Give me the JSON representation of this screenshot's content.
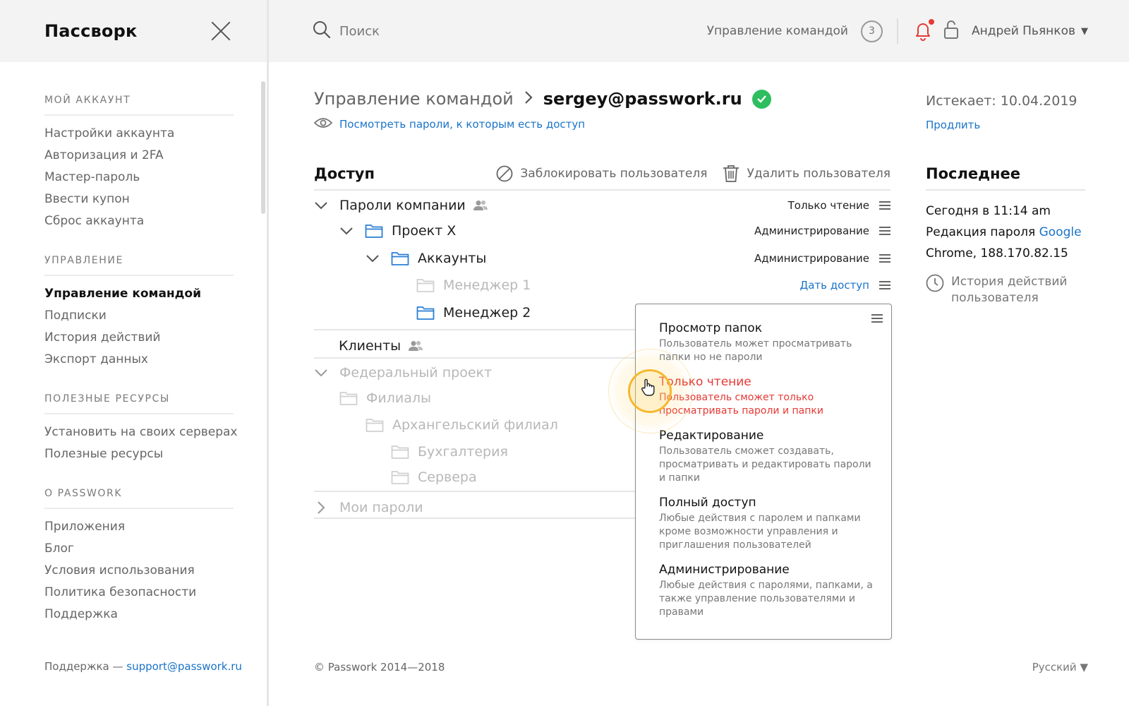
{
  "sidebar": {
    "brand": "Пассворк",
    "sections": [
      {
        "title": "МОЙ АККАУНТ",
        "items": [
          "Настройки аккаунта",
          "Авторизация и 2FA",
          "Мастер-пароль",
          "Ввести купон",
          "Сброс аккаунта"
        ]
      },
      {
        "title": "УПРАВЛЕНИЕ",
        "items": [
          "Управление командой",
          "Подписки",
          "История действий",
          "Экспорт данных"
        ],
        "active": "Управление командой"
      },
      {
        "title": "ПОЛЕЗНЫЕ РЕСУРСЫ",
        "items": [
          "Установить на своих серверах",
          "Полезные ресурсы"
        ]
      },
      {
        "title": "О PASSWORK",
        "items": [
          "Приложения",
          "Блог",
          "Условия использования",
          "Политика безопасности",
          "Поддержка"
        ]
      }
    ],
    "footer_label": "Поддержка —",
    "footer_email": "support@passwork.ru"
  },
  "topbar": {
    "search_placeholder": "Поиск",
    "team_link": "Управление командой",
    "team_count": "3",
    "user_name": "Андрей Пьянков"
  },
  "main": {
    "breadcrumb_parent": "Управление командой",
    "breadcrumb_current": "sergey@passwork.ru",
    "view_link": "Посмотреть пароли, к которым есть доступ",
    "access_title": "Доступ",
    "block_user": "Заблокировать пользователя",
    "delete_user": "Удалить пользователя",
    "tree": [
      {
        "label": "Пароли компании",
        "perm": "Только чтение"
      },
      {
        "label": "Проект X",
        "perm": "Администрирование"
      },
      {
        "label": "Аккаунты",
        "perm": "Администрирование"
      },
      {
        "label": "Менеджер 1",
        "perm": "Дать доступ"
      },
      {
        "label": "Менеджер 2"
      },
      {
        "label": "Клиенты"
      },
      {
        "label": "Федеральный проект"
      },
      {
        "label": "Филиалы"
      },
      {
        "label": "Архангельский филиал"
      },
      {
        "label": "Бухгалтерия"
      },
      {
        "label": "Сервера"
      },
      {
        "label": "Мои пароли"
      }
    ]
  },
  "dropdown": {
    "selected": "Только чтение",
    "options": [
      {
        "title": "Просмотр папок",
        "desc": "Пользователь может просматривать папки но не пароли"
      },
      {
        "title": "Только чтение",
        "desc": "Пользователь сможет только просматривать пароли и папки"
      },
      {
        "title": "Редактирование",
        "desc": "Пользователь сможет создавать, просматривать и редактировать пароли и папки"
      },
      {
        "title": "Полный доступ",
        "desc": "Любые действия с паролем и папками кроме возможности управления и приглашения пользователей"
      },
      {
        "title": "Администрирование",
        "desc": "Любые действия с паролями, папками, а также управление пользователями и правами"
      }
    ]
  },
  "aside": {
    "expires": "Истекает: 10.04.2019",
    "renew": "Продлить",
    "last_title": "Последнее",
    "last_line1": "Сегодня в 11:14 am",
    "last_line2": "Редакция пароля",
    "last_link": "Google",
    "last_line3": "Chrome, 188.170.82.15",
    "history": "История действий пользователя"
  },
  "footer": {
    "copyright": "© Passwork 2014—2018",
    "language": "Русский"
  },
  "colors": {
    "accent": "#1a73c8",
    "danger": "#e53935",
    "success": "#2ebd5f"
  }
}
